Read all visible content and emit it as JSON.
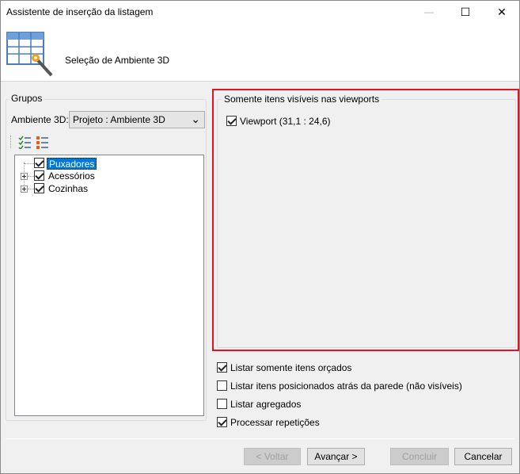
{
  "window": {
    "title": "Assistente de inserção da listagem",
    "min_glyph": "—",
    "max_glyph": "☐",
    "close_glyph": "✕"
  },
  "header": {
    "title": "Seleção de Ambiente 3D",
    "icon": "table-wizard-icon"
  },
  "groups": {
    "legend": "Grupos",
    "ambiente_label": "Ambiente 3D:",
    "ambiente_value": "Projeto : Ambiente 3D",
    "combo_arrow": "⌄",
    "toolbar_icons": [
      "check-all-icon",
      "uncheck-all-icon"
    ],
    "tree": [
      {
        "label": "Puxadores",
        "checked": true,
        "expandable": false,
        "selected": true
      },
      {
        "label": "Acessórios",
        "checked": true,
        "expandable": true,
        "selected": false
      },
      {
        "label": "Cozinhas",
        "checked": true,
        "expandable": true,
        "selected": false
      }
    ]
  },
  "viewports": {
    "legend": "Somente itens visíveis nas viewports",
    "items": [
      {
        "label": "Viewport (31,1 : 24,6)",
        "checked": true
      }
    ]
  },
  "options": [
    {
      "label": "Listar somente itens orçados",
      "checked": true
    },
    {
      "label": "Listar itens posicionados atrás da parede (não visíveis)",
      "checked": false
    },
    {
      "label": "Listar agregados",
      "checked": false
    },
    {
      "label": "Processar repetições",
      "checked": true
    }
  ],
  "buttons": {
    "back": "< Voltar",
    "next": "Avançar >",
    "finish": "Concluir",
    "cancel": "Cancelar"
  },
  "colors": {
    "highlight_border": "#e81123",
    "selection": "#0078d7"
  }
}
